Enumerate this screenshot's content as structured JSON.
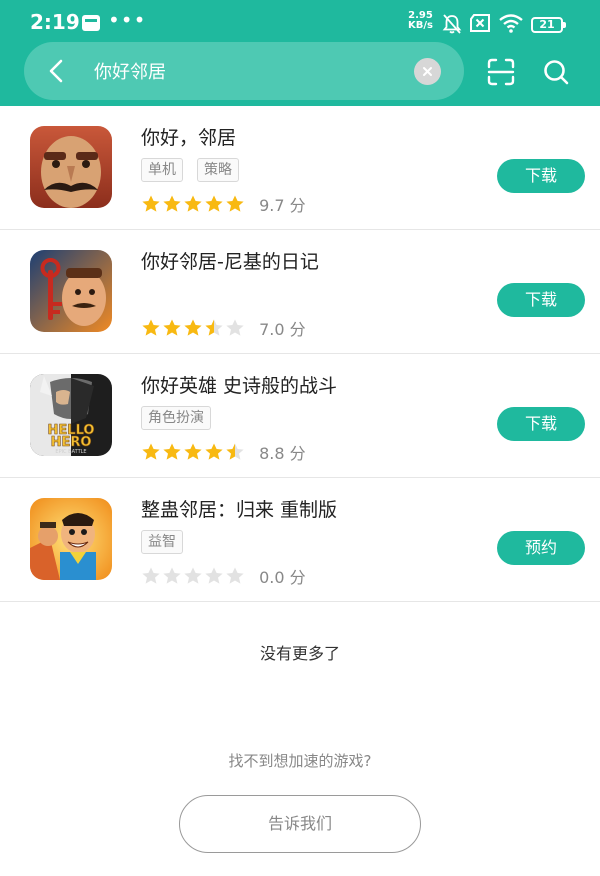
{
  "status_bar": {
    "time": "2:19",
    "dots": "•••",
    "net_speed_value": "2.95",
    "net_speed_unit": "KB/s",
    "battery": "21"
  },
  "search": {
    "query": "你好邻居"
  },
  "colors": {
    "accent": "#1fb99e",
    "star_filled": "#f8b912",
    "star_empty": "#e2e2e2"
  },
  "games": [
    {
      "name": "你好，邻居",
      "tags": [
        "单机",
        "策略"
      ],
      "stars": 5,
      "score": "9.7",
      "score_unit": "分",
      "button": "下载"
    },
    {
      "name": "你好邻居-尼基的日记",
      "tags": [],
      "stars": 3.5,
      "score": "7.0",
      "score_unit": "分",
      "button": "下载"
    },
    {
      "name": "你好英雄 史诗般的战斗",
      "tags": [
        "角色扮演"
      ],
      "stars": 4.5,
      "score": "8.8",
      "score_unit": "分",
      "button": "下载"
    },
    {
      "name": "整蛊邻居：归来 重制版",
      "tags": [
        "益智"
      ],
      "stars": 0,
      "score": "0.0",
      "score_unit": "分",
      "button": "预约"
    }
  ],
  "game_icons": [
    {
      "icon": "neighbor-face-icon"
    },
    {
      "icon": "nicky-diary-icon",
      "logo_text": ""
    },
    {
      "icon": "hello-hero-icon",
      "logo_line1": "HELLO",
      "logo_line2": "HERO",
      "logo_line3": "EPIC BATTLE"
    },
    {
      "icon": "prank-neighbor-icon"
    }
  ],
  "footer": {
    "no_more": "没有更多了",
    "cant_find": "找不到想加速的游戏?",
    "tell_us": "告诉我们"
  }
}
